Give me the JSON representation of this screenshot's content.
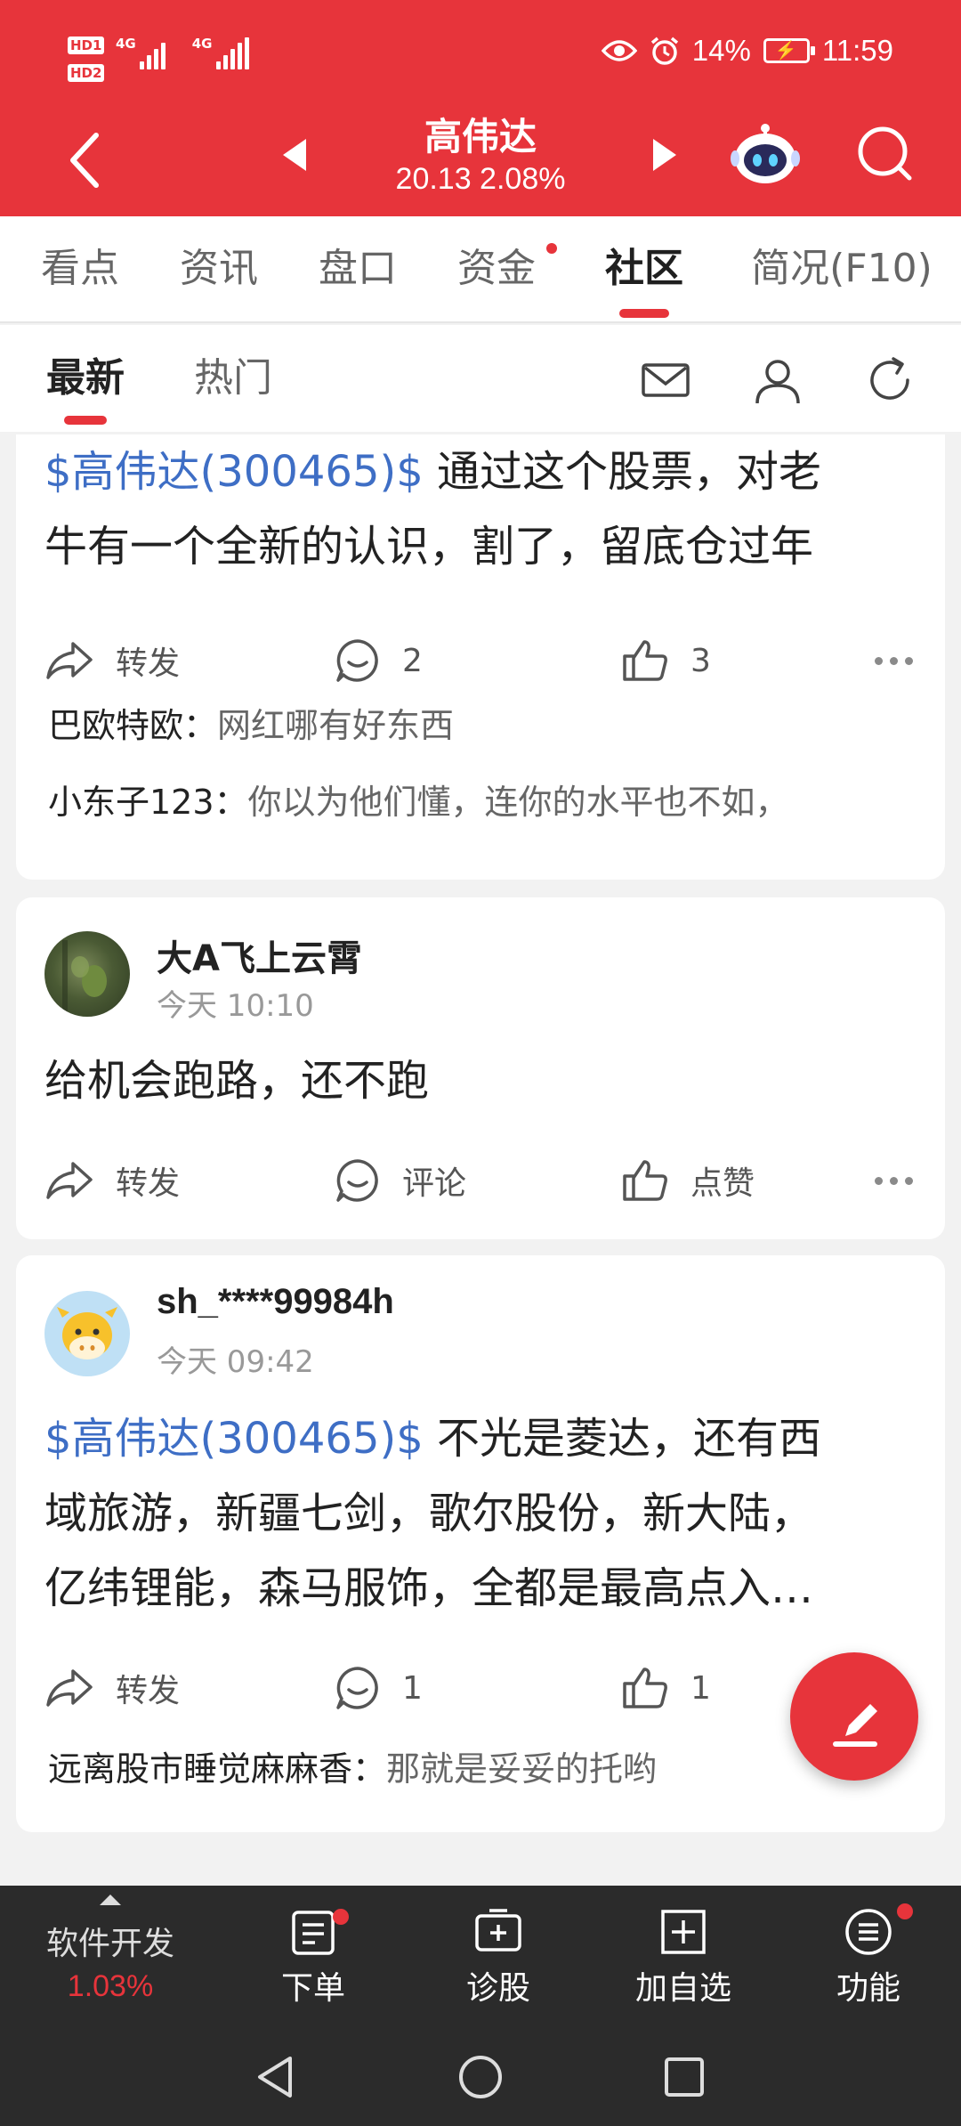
{
  "status_bar": {
    "hd1": "HD1",
    "hd2": "HD2",
    "network1": "4G",
    "network2": "4G",
    "battery_percent": "14%",
    "time": "11:59"
  },
  "header": {
    "stock_name": "高伟达",
    "stock_quote": "20.13  2.08%"
  },
  "main_tabs": [
    {
      "label": "看点"
    },
    {
      "label": "资讯"
    },
    {
      "label": "盘口"
    },
    {
      "label": "资金"
    },
    {
      "label": "社区"
    },
    {
      "label": "简况(F10)"
    }
  ],
  "sub_tabs": [
    {
      "label": "最新"
    },
    {
      "label": "热门"
    }
  ],
  "posts": [
    {
      "tag": "$高伟达(300465)$",
      "line1": " 通过这个股票，对老",
      "line2": "牛有一个全新的认识，割了，留底仓过年",
      "forward": "转发",
      "comments": "2",
      "likes": "3",
      "replies": [
        {
          "user": "巴欧特欧：",
          "text": "网红哪有好东西"
        },
        {
          "user": "小东子123：",
          "text": "你以为他们懂，连你的水平也不如，"
        }
      ]
    },
    {
      "username": "大A飞上云霄",
      "time": "今天 10:10",
      "text": "给机会跑路，还不跑",
      "forward": "转发",
      "comments": "评论",
      "likes": "点赞"
    },
    {
      "username": "sh_****99984h",
      "time": "今天 09:42",
      "tag": "$高伟达(300465)$",
      "line1": " 不光是菱达，还有西",
      "line2": "域旅游，新疆七剑，歌尔股份，新大陆，",
      "line3": "亿纬锂能，森马服饰，全都是最高点入…",
      "forward": "转发",
      "comments": "1",
      "likes": "1",
      "replies": [
        {
          "user": "远离股市睡觉麻麻香：",
          "text": "那就是妥妥的托哟"
        }
      ]
    }
  ],
  "toolbar": {
    "sector_name": "软件开发",
    "sector_change": "1.03%",
    "items": [
      {
        "label": "下单",
        "icon": "order-icon"
      },
      {
        "label": "诊股",
        "icon": "diagnose-icon"
      },
      {
        "label": "加自选",
        "icon": "add-watchlist-icon"
      },
      {
        "label": "功能",
        "icon": "menu-icon"
      }
    ]
  },
  "colors": {
    "brand_red": "#e7343b",
    "link_blue": "#3e6ec5",
    "toolbar_bg": "#2b2b2b"
  }
}
